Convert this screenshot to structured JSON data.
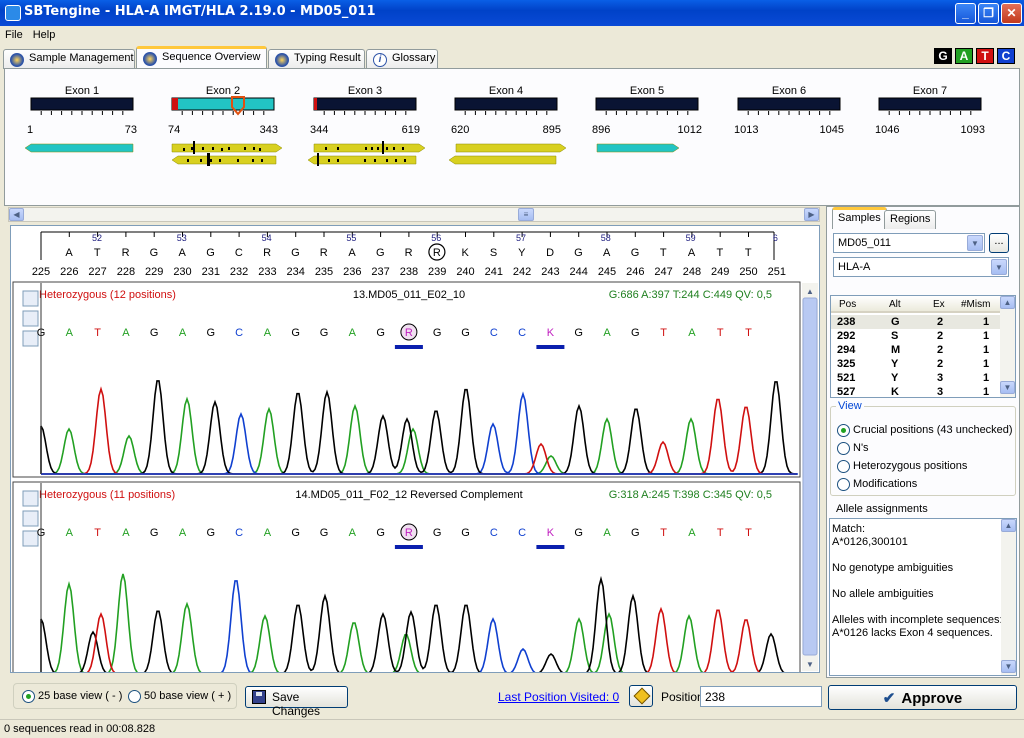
{
  "window": {
    "title": "SBTengine - HLA-A IMGT/HLA 2.19.0 - MD05_011"
  },
  "menu": [
    "File",
    "Help"
  ],
  "tabs": [
    "Sample Management",
    "Sequence Overview",
    "Typing Result",
    "Glossary"
  ],
  "active_tab": "Sequence Overview",
  "bases": [
    {
      "label": "G",
      "color": "#000000"
    },
    {
      "label": "A",
      "color": "#22a022"
    },
    {
      "label": "T",
      "color": "#d01010"
    },
    {
      "label": "C",
      "color": "#1040d0"
    }
  ],
  "exons": [
    {
      "name": "Exon 1",
      "start": "1",
      "end": "73"
    },
    {
      "name": "Exon 2",
      "start": "74",
      "end": "343"
    },
    {
      "name": "Exon 3",
      "start": "344",
      "end": "619"
    },
    {
      "name": "Exon 4",
      "start": "620",
      "end": "895"
    },
    {
      "name": "Exon 5",
      "start": "896",
      "end": "1012"
    },
    {
      "name": "Exon 6",
      "start": "1013",
      "end": "1045"
    },
    {
      "name": "Exon 7",
      "start": "1046",
      "end": "1093"
    }
  ],
  "ruler": {
    "codons": [
      "52",
      "53",
      "54",
      "55",
      "56",
      "57",
      "58",
      "59",
      "6"
    ],
    "consensus": [
      "A",
      "T",
      "R",
      "G",
      "A",
      "G",
      "C",
      "R",
      "G",
      "R",
      "A",
      "G",
      "R",
      "R",
      "K",
      "S",
      "Y",
      "D",
      "G",
      "A",
      "G",
      "T",
      "A",
      "T",
      "T"
    ],
    "positions": [
      "225",
      "226",
      "227",
      "228",
      "229",
      "230",
      "231",
      "232",
      "233",
      "234",
      "235",
      "236",
      "237",
      "238",
      "239",
      "240",
      "241",
      "242",
      "243",
      "244",
      "245",
      "246",
      "247",
      "248",
      "249",
      "250",
      "251"
    ],
    "selected_base": "R"
  },
  "traces": [
    {
      "status": "Heterozygous (12 positions)",
      "name": "13.MD05_011_E02_10",
      "stats": "G:686 A:397 T:244 C:449 QV: 0,5",
      "bases": [
        "G",
        "A",
        "T",
        "A",
        "G",
        "A",
        "G",
        "C",
        "A",
        "G",
        "G",
        "A",
        "G",
        "R",
        "G",
        "G",
        "C",
        "C",
        "K",
        "G",
        "A",
        "G",
        "T",
        "A",
        "T",
        "T"
      ]
    },
    {
      "status": "Heterozygous (11 positions)",
      "name": "14.MD05_011_F02_12 Reversed Complement",
      "stats": "G:318 A:245 T:398 C:345 QV: 0,5",
      "bases": [
        "G",
        "A",
        "T",
        "A",
        "G",
        "A",
        "G",
        "C",
        "A",
        "G",
        "G",
        "A",
        "G",
        "R",
        "G",
        "G",
        "C",
        "C",
        "K",
        "G",
        "A",
        "G",
        "T",
        "A",
        "T",
        "T"
      ]
    }
  ],
  "right": {
    "tabs": [
      "Samples",
      "Regions"
    ],
    "sample": "MD05_011",
    "locus": "HLA-A",
    "ellipsis": "...",
    "grid_headers": [
      "Pos",
      "Alt",
      "Ex",
      "#Mism"
    ],
    "grid_rows": [
      [
        "238",
        "G",
        "2",
        "1"
      ],
      [
        "292",
        "S",
        "2",
        "1"
      ],
      [
        "294",
        "M",
        "2",
        "1"
      ],
      [
        "325",
        "Y",
        "2",
        "1"
      ],
      [
        "521",
        "Y",
        "3",
        "1"
      ],
      [
        "527",
        "K",
        "3",
        "1"
      ]
    ],
    "view": {
      "legend": "View",
      "options": [
        "Crucial positions (43 unchecked)",
        "N's",
        "Heterozygous positions",
        "Modifications"
      ],
      "selected": 0
    },
    "allele_title": "Allele assignments",
    "allele_lines": [
      "Match:",
      "A*0126,300101",
      "No genotype ambiguities",
      "No allele ambiguities",
      "Alleles with incomplete sequences:",
      "A*0126 lacks Exon 4 sequences."
    ]
  },
  "bottom": {
    "view25": "25 base view ( - )",
    "view50": "50 base view ( + )",
    "save": "Save Changes",
    "last_pos": "Last Position Visited: 0",
    "position_label": "Position",
    "position_value": "238",
    "approve": "Approve"
  },
  "status": "0 sequences read in 00:08.828",
  "colors": {
    "G": "#000000",
    "A": "#22a022",
    "T": "#d01010",
    "C": "#1040d0",
    "ambig": "#c020c0"
  }
}
